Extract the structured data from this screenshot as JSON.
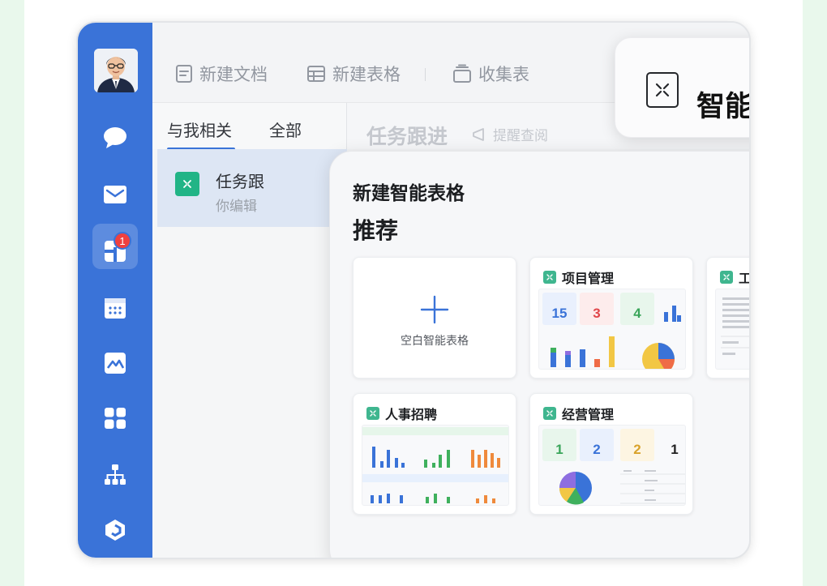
{
  "toolbar": {
    "new_doc": "新建文档",
    "new_sheet": "新建表格",
    "collect_form": "收集表"
  },
  "tabs": [
    "与我相关",
    "全部"
  ],
  "list_item": {
    "title": "任务跟",
    "subtitle": "你编辑"
  },
  "right_header": {
    "title": "任务跟进",
    "remind": "提醒查阅"
  },
  "highlight_card": {
    "title": "智能表格"
  },
  "sidebar": {
    "badge_count": "1"
  },
  "modal": {
    "title": "新建智能表格",
    "section": "推荐",
    "blank_label": "空白智能表格",
    "templates": [
      {
        "name": "项目管理",
        "stats": [
          "15",
          "3",
          "4"
        ]
      },
      {
        "name": "工作汇报"
      },
      {
        "name": "人事招聘"
      },
      {
        "name": "经营管理",
        "stats": [
          "1",
          "2",
          "2",
          "1"
        ]
      }
    ]
  },
  "colors": {
    "sidebar": "#3a73d8",
    "accent_green": "#21b486",
    "badge_red": "#ef4040",
    "page_background": "#e9f8ec"
  }
}
